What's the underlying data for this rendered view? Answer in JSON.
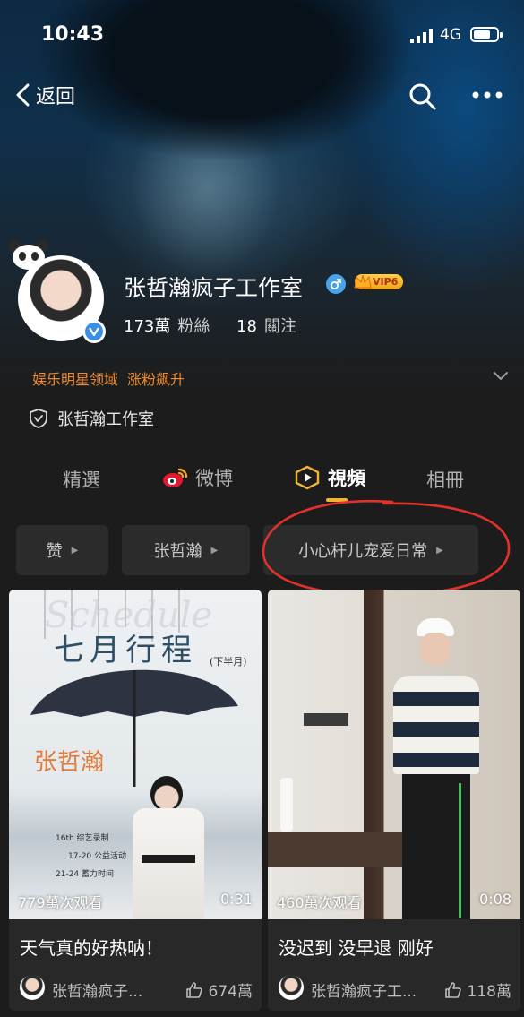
{
  "status_bar": {
    "time": "10:43",
    "network": "4G"
  },
  "nav": {
    "back_label": "返回"
  },
  "profile": {
    "name": "张哲瀚疯子工作室",
    "vip_label": "VIP6",
    "followers_count": "173萬",
    "followers_label": "粉絲",
    "following_count": "18",
    "following_label": "關注",
    "tags": [
      "娱乐明星领域",
      "涨粉飙升"
    ],
    "verification_text": "张哲瀚工作室"
  },
  "tabs": [
    {
      "label": "精選"
    },
    {
      "label": "微博"
    },
    {
      "label": "視頻"
    },
    {
      "label": "相冊"
    }
  ],
  "filter_chips": [
    {
      "label": "赞"
    },
    {
      "label": "张哲瀚"
    },
    {
      "label": "小心杆儿宠爱日常"
    }
  ],
  "videos": [
    {
      "views": "779萬次观看",
      "duration": "0:31",
      "title": "天气真的好热呐！",
      "author": "张哲瀚疯子...",
      "likes": "674萬",
      "poster_title": "七月行程",
      "poster_subtitle": "(下半月)",
      "poster_name": "张哲瀚",
      "poster_script": "Schedule",
      "poster_lines": [
        "16th 综艺录制",
        "17-20 公益活动",
        "21-24 蓄力时间"
      ]
    },
    {
      "views": "460萬次观看",
      "duration": "0:08",
      "title": "没迟到 没早退 刚好",
      "author": "张哲瀚疯子工...",
      "likes": "118萬"
    }
  ],
  "colors": {
    "accent_orange": "#f08a2c",
    "annotation_red": "#e0312b",
    "verified_blue": "#3a8ee6"
  }
}
